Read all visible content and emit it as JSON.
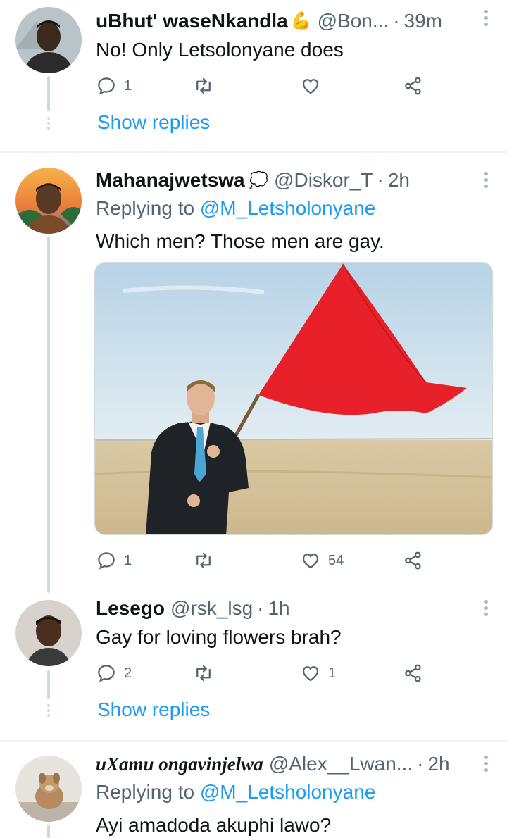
{
  "tweets": [
    {
      "name": "uBhut' waseNkandla",
      "name_emoji": "💪",
      "handle": "@Bon...",
      "time": "39m",
      "text": "No! Only Letsolonyane does",
      "reply_count": "1",
      "retweet_count": "",
      "like_count": "",
      "show_replies": "Show replies"
    },
    {
      "name": "Mahanajwetswa",
      "name_emoji": "💭",
      "handle": "@Diskor_T",
      "time": "2h",
      "replying_prefix": "Replying to ",
      "replying_to": "@M_Letsholonyane",
      "text": "Which men? Those men are gay.",
      "media": "Man in a suit holding a large red flag in the desert",
      "reply_count": "1",
      "retweet_count": "",
      "like_count": "54"
    },
    {
      "name": "Lesego",
      "handle": "@rsk_lsg",
      "time": "1h",
      "text": "Gay for loving flowers brah?",
      "reply_count": "2",
      "retweet_count": "",
      "like_count": "1",
      "show_replies": "Show replies"
    },
    {
      "name": "uXamu ongavinjelwa",
      "handle": "@Alex__Lwan...",
      "time": "2h",
      "replying_prefix": "Replying to ",
      "replying_to": "@M_Letsholonyane",
      "text": "Ayi amadoda akuphi lawo?"
    }
  ],
  "separator": "·",
  "colors": {
    "accent": "#1d9bf0",
    "secondary_text": "#536471",
    "primary_text": "#0f1419",
    "flag": "#e8202a"
  },
  "icons": [
    "reply-icon",
    "retweet-icon",
    "like-icon",
    "share-icon",
    "more-icon"
  ]
}
